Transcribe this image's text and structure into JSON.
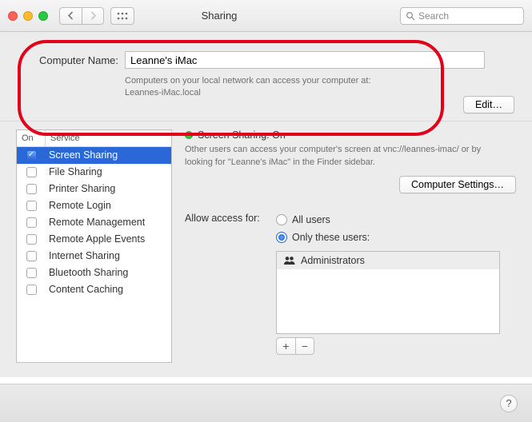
{
  "window": {
    "title": "Sharing",
    "search_placeholder": "Search"
  },
  "computer": {
    "label": "Computer Name:",
    "value": "Leanne's iMac",
    "desc_line1": "Computers on your local network can access your computer at:",
    "desc_line2": "Leannes-iMac.local",
    "edit_label": "Edit…"
  },
  "services": {
    "col_on": "On",
    "col_service": "Service",
    "items": [
      {
        "label": "Screen Sharing",
        "checked": true,
        "selected": true
      },
      {
        "label": "File Sharing",
        "checked": false,
        "selected": false
      },
      {
        "label": "Printer Sharing",
        "checked": false,
        "selected": false
      },
      {
        "label": "Remote Login",
        "checked": false,
        "selected": false
      },
      {
        "label": "Remote Management",
        "checked": false,
        "selected": false
      },
      {
        "label": "Remote Apple Events",
        "checked": false,
        "selected": false
      },
      {
        "label": "Internet Sharing",
        "checked": false,
        "selected": false
      },
      {
        "label": "Bluetooth Sharing",
        "checked": false,
        "selected": false
      },
      {
        "label": "Content Caching",
        "checked": false,
        "selected": false
      }
    ]
  },
  "detail": {
    "status_title": "Screen Sharing: On",
    "status_desc": "Other users can access your computer's screen at vnc://leannes-imac/ or by looking for \"Leanne's iMac\" in the Finder sidebar.",
    "settings_label": "Computer Settings…",
    "access_label": "Allow access for:",
    "radio_all": "All users",
    "radio_only": "Only these users:",
    "radio_selected": "only",
    "users": [
      {
        "label": "Administrators"
      }
    ],
    "plus": "+",
    "minus": "−"
  },
  "help_label": "?"
}
